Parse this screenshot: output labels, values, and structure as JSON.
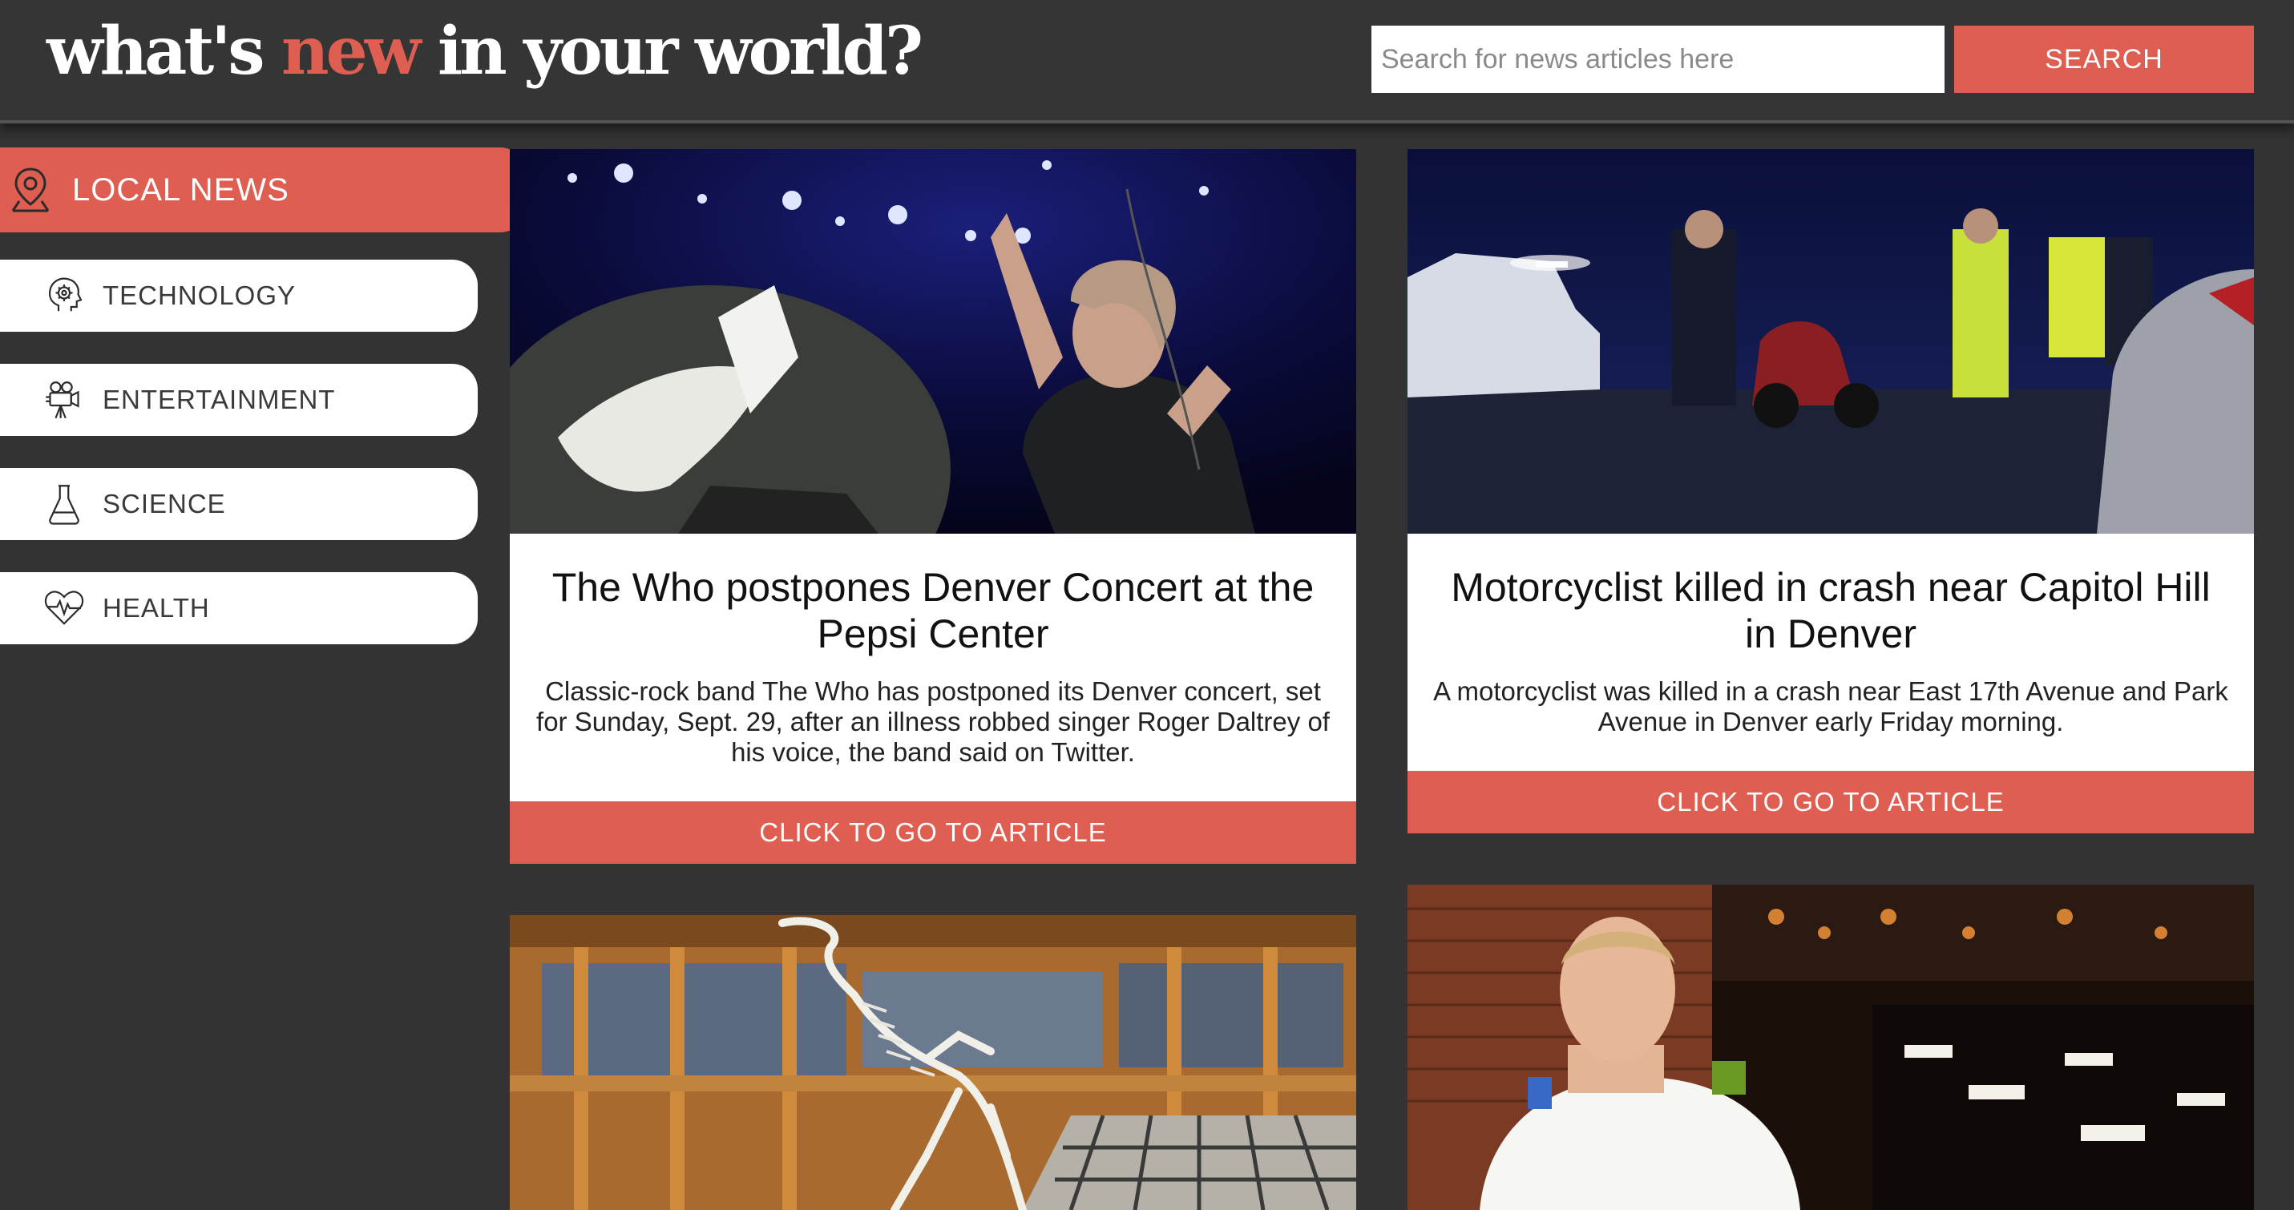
{
  "header": {
    "logo_pre": "what's ",
    "logo_accent": "new",
    "logo_post": " in your world?",
    "search_placeholder": "Search for news articles here",
    "search_button": "SEARCH"
  },
  "colors": {
    "accent": "#de5e52",
    "background": "#333333",
    "card": "#ffffff"
  },
  "sidebar": {
    "items": [
      {
        "label": "LOCAL NEWS",
        "icon": "map-pin-icon",
        "active": true
      },
      {
        "label": "TECHNOLOGY",
        "icon": "brain-gear-icon",
        "active": false
      },
      {
        "label": "ENTERTAINMENT",
        "icon": "film-camera-icon",
        "active": false
      },
      {
        "label": "SCIENCE",
        "icon": "flask-icon",
        "active": false
      },
      {
        "label": "HEALTH",
        "icon": "heartbeat-icon",
        "active": false
      }
    ]
  },
  "articles": [
    {
      "title": "The Who postpones Denver Concert at the Pepsi Center",
      "summary": "Classic-rock band The Who has postponed its Denver concert, set for Sunday, Sept. 29, after an illness robbed singer Roger Daltrey of his voice, the band said on Twitter.",
      "link": "CLICK TO GO TO ARTICLE"
    },
    {
      "title": "Motorcyclist killed in crash near Capitol Hill in Denver",
      "summary": "A motorcyclist was killed in a crash near East 17th Avenue and Park Avenue in Denver early Friday morning.",
      "link": "CLICK TO GO TO ARTICLE"
    }
  ]
}
